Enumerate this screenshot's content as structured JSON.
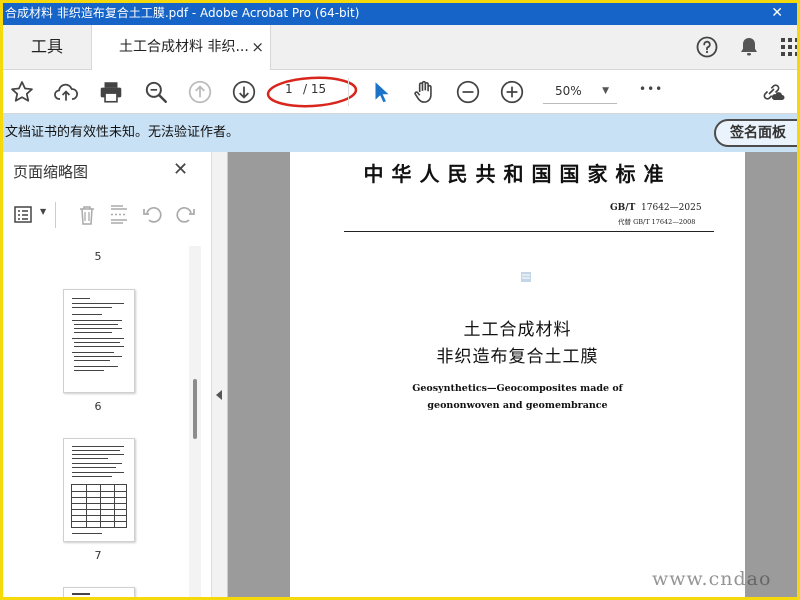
{
  "window": {
    "title": "合成材料 非织造布复合土工膜.pdf - Adobe Acrobat Pro (64-bit)",
    "close_glyph": "✕"
  },
  "tabs": {
    "tools_label": "工具",
    "doc_label": "土工合成材料 非织...",
    "close_glyph": "×"
  },
  "toolbar": {
    "current_page": "1",
    "total_pages": "/ 15",
    "zoom": "50%",
    "more": "•••"
  },
  "notice": {
    "message": "文档证书的有效性未知。无法验证作者。",
    "sign_panel_button": "签名面板"
  },
  "panel": {
    "title": "页面缩略图",
    "close_glyph": "✕",
    "pages": [
      "5",
      "6",
      "7"
    ]
  },
  "document": {
    "standard_title": "中华人民共和国国家标准",
    "code_prefix": "GB/T",
    "code_number": "17642—2025",
    "replaces_prefix": "代替",
    "replaces_code": "GB/T 17642—2008",
    "title_zh_line1": "土工合成材料",
    "title_zh_line2": "非织造布复合土工膜",
    "title_en_line1": "Geosynthetics—Geocomposites made of",
    "title_en_line2": "geononwoven and geomembrance"
  },
  "icons": {
    "star": "star-icon",
    "upload": "upload-cloud-icon",
    "print": "print-icon",
    "search": "zoom-search-icon",
    "prev": "previous-page-icon",
    "next": "next-page-icon",
    "select": "select-arrow-icon",
    "hand": "hand-tool-icon",
    "zoom_out": "zoom-out-icon",
    "zoom_in": "zoom-in-icon",
    "share": "share-link-icon",
    "help": "help-icon",
    "bell": "bell-icon",
    "apps": "apps-grid-icon"
  },
  "colors": {
    "titlebar": "#1764c8",
    "notice_bg": "#c9e1f5",
    "accent_blue": "#1a73c9",
    "annotation_red": "#d9261c",
    "border_yellow": "#f5d90a"
  }
}
